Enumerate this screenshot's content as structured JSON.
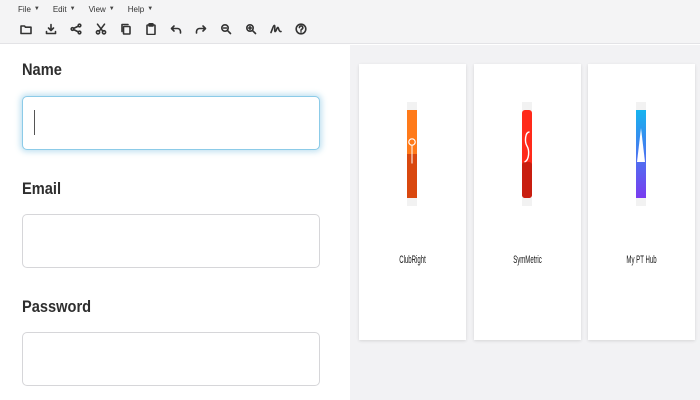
{
  "menubar": {
    "items": [
      {
        "label": "File"
      },
      {
        "label": "Edit"
      },
      {
        "label": "View"
      },
      {
        "label": "Help"
      }
    ]
  },
  "toolbar": {
    "buttons": [
      {
        "icon": "folder-icon"
      },
      {
        "icon": "download-icon"
      },
      {
        "icon": "share-icon"
      },
      {
        "icon": "scissors-icon"
      },
      {
        "icon": "copy-icon"
      },
      {
        "icon": "clipboard-icon"
      },
      {
        "icon": "undo-icon"
      },
      {
        "icon": "redo-icon"
      },
      {
        "icon": "zoom-out-icon"
      },
      {
        "icon": "zoom-in-icon"
      },
      {
        "icon": "signature-icon"
      },
      {
        "icon": "help-icon"
      }
    ]
  },
  "form": {
    "name_label": "Name",
    "email_label": "Email",
    "password_label": "Password",
    "name_value": "",
    "email_value": "",
    "password_value": ""
  },
  "cards": [
    {
      "name": "ClubRight",
      "logo_colors": [
        "#ff7a1a",
        "#d9480f"
      ]
    },
    {
      "name": "SymMetric",
      "logo_colors": [
        "#ff2a1a",
        "#c81e10"
      ]
    },
    {
      "name": "My PT Hub",
      "logo_colors": [
        "#16b4ef",
        "#7a3cf0"
      ]
    }
  ]
}
